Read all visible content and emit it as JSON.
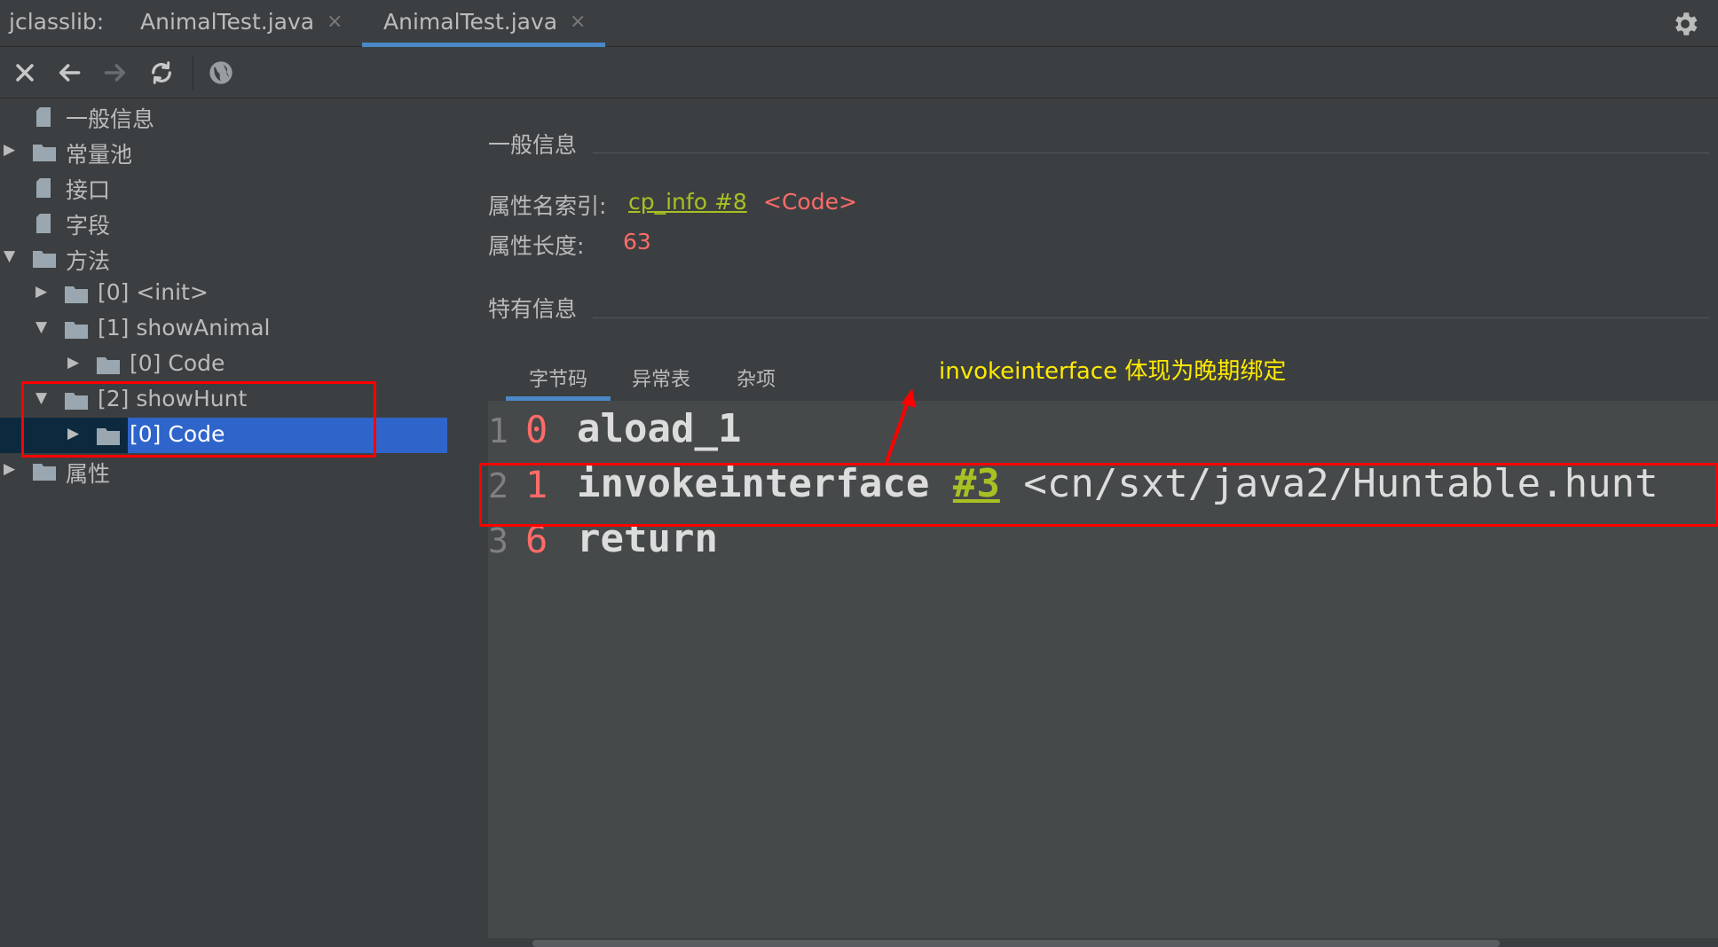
{
  "tabbar": {
    "prefix": "jclasslib:",
    "tabs": [
      {
        "label": "AnimalTest.java",
        "close": "×"
      },
      {
        "label": "AnimalTest.java",
        "close": "×"
      }
    ]
  },
  "toolbar": {
    "icons": [
      "close-icon",
      "back-arrow-icon",
      "forward-arrow-icon",
      "refresh-icon",
      "globe-icon"
    ]
  },
  "tree": {
    "items": [
      {
        "label": "一般信息"
      },
      {
        "label": "常量池"
      },
      {
        "label": "接口"
      },
      {
        "label": "字段"
      },
      {
        "label": "方法"
      },
      {
        "label": "[0] <init>"
      },
      {
        "label": "[1] showAnimal"
      },
      {
        "label": "[0] Code"
      },
      {
        "label": "[2] showHunt"
      },
      {
        "label": "[0] Code"
      },
      {
        "label": "属性"
      }
    ]
  },
  "general": {
    "title": "一般信息",
    "name_index_label": "属性名索引:",
    "name_index_link": "cp_info #8",
    "name_index_value": "<Code>",
    "length_label": "属性长度:",
    "length_value": "63"
  },
  "specific": {
    "title": "特有信息",
    "tabs": [
      "字节码",
      "异常表",
      "杂项"
    ]
  },
  "annotation": "invokeinterface 体现为晚期绑定",
  "bytecode": [
    {
      "line": "1",
      "offset": "0",
      "opcode": "aload_1",
      "ref": "",
      "comment": ""
    },
    {
      "line": "2",
      "offset": "1",
      "opcode": "invokeinterface",
      "ref": "#3",
      "comment": "<cn/sxt/java2/Huntable.hunt"
    },
    {
      "line": "3",
      "offset": "6",
      "opcode": "return",
      "ref": "",
      "comment": ""
    }
  ],
  "colors": {
    "background": "#3c3f41",
    "code_background": "#45494a",
    "selection": "#2f65ca",
    "link_green": "#a8c023",
    "accent_red": "#ff6b68",
    "annotation_yellow": "#ffea00",
    "highlight_box": "#ff0000"
  }
}
